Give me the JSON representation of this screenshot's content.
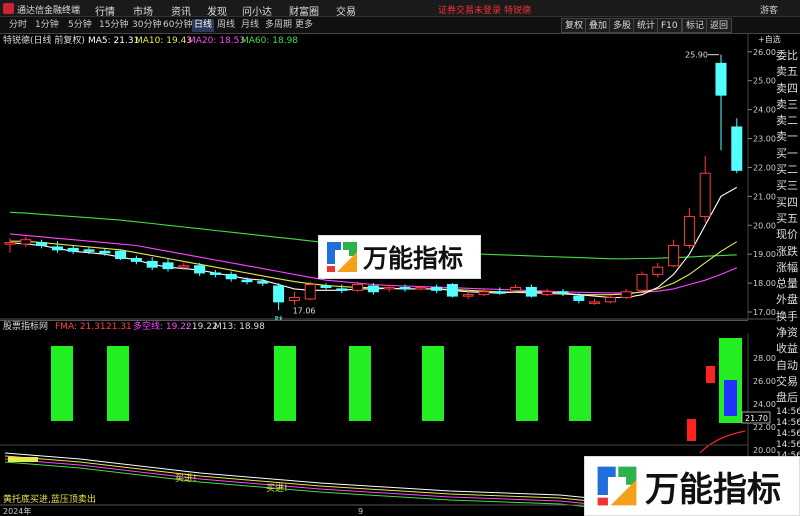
{
  "app": {
    "title": "通达信金融终端",
    "menu": [
      "行情",
      "市场",
      "资讯",
      "发现",
      "问小达",
      "财富圈",
      "交易"
    ],
    "status": "证券交易未登录",
    "stock_tag": "特锐德",
    "user": "游客"
  },
  "toolbar": {
    "timeframes": [
      "分时",
      "1分钟",
      "5分钟",
      "15分钟",
      "30分钟",
      "60分钟",
      "日线",
      "周线",
      "月线",
      "多周期",
      "更多"
    ],
    "active_timeframe": "日线",
    "tools": [
      "复权",
      "叠加",
      "多股",
      "统计",
      "F10",
      "标记",
      "返回"
    ]
  },
  "info": {
    "stock": "特锐德(日线 前复权)",
    "ma5": "MA5: 21.31",
    "ma10": "MA10: 19.43",
    "ma20": "MA20: 18.53",
    "ma60": "MA60: 18.98",
    "self_select": "+自选",
    "colors": {
      "ma5": "#ffffff",
      "ma10": "#e8e84a",
      "ma20": "#ff44ff",
      "ma60": "#44dd44"
    }
  },
  "right_panel": [
    "委比",
    "卖五",
    "卖四",
    "卖三",
    "卖二",
    "卖一",
    "买一",
    "买二",
    "买三",
    "买四",
    "买五",
    "现价",
    "涨跌",
    "涨幅",
    "总量",
    "外盘",
    "换手",
    "净资",
    "收益",
    "自动",
    "交易",
    "盘后",
    "14:56",
    "14:56",
    "14:56",
    "14:56",
    "14:56"
  ],
  "price_axis": [
    "26.00",
    "25.00",
    "24.00",
    "23.00",
    "22.00",
    "21.00",
    "20.00",
    "19.00",
    "18.00",
    "17.00"
  ],
  "price_labels": {
    "high": "25.90",
    "low": "17.06",
    "fin": "财"
  },
  "sub": {
    "title": "股票指标网",
    "fma": "FMA: 21.31",
    "fma2": "21.31",
    "duokong": "多空线: 19.22",
    "v2": ": 19.22",
    "m13": "M13: 18.98",
    "colors": {
      "fma": "#ff4444",
      "duokong": "#ff44ff",
      "m13": "#dddddd"
    },
    "axis": [
      "28.00",
      "26.00",
      "24.00",
      "22.00",
      "20.00"
    ],
    "value_label": "21.70"
  },
  "lower": {
    "signal1": "买进!",
    "signal2": "买进!",
    "legend": "黄托底买进,蓝压顶卖出",
    "year": "2024年",
    "month": "9"
  },
  "watermark": "万能指标",
  "chart_data": {
    "type": "candlestick",
    "ylim": [
      17.0,
      26.2
    ],
    "candles": [
      {
        "o": 19.35,
        "c": 19.4,
        "h": 19.55,
        "l": 19.05
      },
      {
        "o": 19.35,
        "c": 19.5,
        "h": 19.6,
        "l": 19.25
      },
      {
        "o": 19.4,
        "c": 19.3,
        "h": 19.5,
        "l": 19.2
      },
      {
        "o": 19.25,
        "c": 19.15,
        "h": 19.45,
        "l": 19.05
      },
      {
        "o": 19.2,
        "c": 19.1,
        "h": 19.3,
        "l": 19.0
      },
      {
        "o": 19.15,
        "c": 19.1,
        "h": 19.25,
        "l": 19.0
      },
      {
        "o": 19.1,
        "c": 19.05,
        "h": 19.2,
        "l": 18.95
      },
      {
        "o": 19.1,
        "c": 18.85,
        "h": 19.15,
        "l": 18.8
      },
      {
        "o": 18.85,
        "c": 18.75,
        "h": 18.95,
        "l": 18.65
      },
      {
        "o": 18.75,
        "c": 18.55,
        "h": 18.9,
        "l": 18.45
      },
      {
        "o": 18.7,
        "c": 18.5,
        "h": 18.85,
        "l": 18.4
      },
      {
        "o": 18.55,
        "c": 18.6,
        "h": 18.7,
        "l": 18.45
      },
      {
        "o": 18.6,
        "c": 18.35,
        "h": 18.7,
        "l": 18.25
      },
      {
        "o": 18.35,
        "c": 18.3,
        "h": 18.45,
        "l": 18.2
      },
      {
        "o": 18.3,
        "c": 18.15,
        "h": 18.4,
        "l": 18.05
      },
      {
        "o": 18.1,
        "c": 18.05,
        "h": 18.2,
        "l": 17.95
      },
      {
        "o": 18.05,
        "c": 18.0,
        "h": 18.15,
        "l": 17.9
      },
      {
        "o": 17.9,
        "c": 17.35,
        "h": 18.0,
        "l": 17.06
      },
      {
        "o": 17.4,
        "c": 17.5,
        "h": 17.7,
        "l": 17.25
      },
      {
        "o": 17.45,
        "c": 17.95,
        "h": 18.05,
        "l": 17.4
      },
      {
        "o": 17.9,
        "c": 17.85,
        "h": 18.0,
        "l": 17.75
      },
      {
        "o": 17.8,
        "c": 17.75,
        "h": 17.95,
        "l": 17.65
      },
      {
        "o": 17.75,
        "c": 17.95,
        "h": 18.05,
        "l": 17.7
      },
      {
        "o": 17.9,
        "c": 17.7,
        "h": 18.0,
        "l": 17.6
      },
      {
        "o": 17.8,
        "c": 17.85,
        "h": 17.95,
        "l": 17.7
      },
      {
        "o": 17.85,
        "c": 17.8,
        "h": 17.95,
        "l": 17.7
      },
      {
        "o": 17.8,
        "c": 17.85,
        "h": 17.9,
        "l": 17.75
      },
      {
        "o": 17.85,
        "c": 17.75,
        "h": 17.95,
        "l": 17.65
      },
      {
        "o": 17.95,
        "c": 17.55,
        "h": 18.0,
        "l": 17.5
      },
      {
        "o": 17.55,
        "c": 17.6,
        "h": 17.7,
        "l": 17.45
      },
      {
        "o": 17.6,
        "c": 17.7,
        "h": 17.8,
        "l": 17.55
      },
      {
        "o": 17.7,
        "c": 17.65,
        "h": 17.85,
        "l": 17.6
      },
      {
        "o": 17.75,
        "c": 17.85,
        "h": 17.95,
        "l": 17.7
      },
      {
        "o": 17.85,
        "c": 17.55,
        "h": 17.95,
        "l": 17.5
      },
      {
        "o": 17.6,
        "c": 17.7,
        "h": 17.8,
        "l": 17.55
      },
      {
        "o": 17.7,
        "c": 17.65,
        "h": 17.8,
        "l": 17.55
      },
      {
        "o": 17.55,
        "c": 17.4,
        "h": 17.65,
        "l": 17.3
      },
      {
        "o": 17.3,
        "c": 17.35,
        "h": 17.45,
        "l": 17.25
      },
      {
        "o": 17.35,
        "c": 17.5,
        "h": 17.6,
        "l": 17.3
      },
      {
        "o": 17.5,
        "c": 17.7,
        "h": 17.8,
        "l": 17.45
      },
      {
        "o": 17.75,
        "c": 18.3,
        "h": 18.4,
        "l": 17.7
      },
      {
        "o": 18.3,
        "c": 18.55,
        "h": 18.7,
        "l": 18.2
      },
      {
        "o": 18.6,
        "c": 19.3,
        "h": 19.5,
        "l": 18.55
      },
      {
        "o": 19.3,
        "c": 20.3,
        "h": 20.6,
        "l": 19.2
      },
      {
        "o": 20.3,
        "c": 21.8,
        "h": 22.4,
        "l": 20.1
      },
      {
        "o": 25.6,
        "c": 24.5,
        "h": 25.9,
        "l": 22.6
      },
      {
        "o": 23.4,
        "c": 21.9,
        "h": 23.7,
        "l": 21.8
      }
    ],
    "ma5": [
      19.4,
      19.35,
      19.3,
      19.2,
      19.1,
      19.05,
      19.0,
      18.9,
      18.8,
      18.65,
      18.55,
      18.5,
      18.45,
      18.35,
      18.25,
      18.15,
      18.1,
      17.95,
      17.8,
      17.75,
      17.75,
      17.75,
      17.8,
      17.8,
      17.82,
      17.8,
      17.8,
      17.8,
      17.75,
      17.7,
      17.68,
      17.65,
      17.7,
      17.7,
      17.68,
      17.65,
      17.6,
      17.55,
      17.5,
      17.5,
      17.6,
      17.85,
      18.3,
      19.0,
      20.0,
      21.0,
      21.31
    ],
    "ma10": [
      19.45,
      19.45,
      19.4,
      19.35,
      19.3,
      19.25,
      19.2,
      19.15,
      19.05,
      18.95,
      18.85,
      18.75,
      18.65,
      18.55,
      18.45,
      18.35,
      18.25,
      18.15,
      18.05,
      17.98,
      17.92,
      17.88,
      17.85,
      17.84,
      17.82,
      17.8,
      17.8,
      17.8,
      17.78,
      17.75,
      17.72,
      17.7,
      17.68,
      17.66,
      17.64,
      17.62,
      17.6,
      17.6,
      17.6,
      17.62,
      17.7,
      17.8,
      18.0,
      18.3,
      18.7,
      19.1,
      19.43
    ],
    "ma20": [
      19.7,
      19.65,
      19.6,
      19.55,
      19.5,
      19.45,
      19.4,
      19.35,
      19.3,
      19.2,
      19.1,
      19.0,
      18.9,
      18.8,
      18.7,
      18.6,
      18.5,
      18.4,
      18.3,
      18.2,
      18.1,
      18.05,
      18.0,
      17.95,
      17.92,
      17.9,
      17.88,
      17.86,
      17.84,
      17.82,
      17.8,
      17.78,
      17.76,
      17.74,
      17.72,
      17.7,
      17.68,
      17.67,
      17.66,
      17.66,
      17.68,
      17.72,
      17.8,
      17.95,
      18.1,
      18.3,
      18.53
    ],
    "ma60": [
      20.45,
      20.42,
      20.38,
      20.34,
      20.3,
      20.26,
      20.22,
      20.18,
      20.12,
      20.06,
      20.0,
      19.94,
      19.88,
      19.82,
      19.76,
      19.7,
      19.64,
      19.58,
      19.52,
      19.46,
      19.4,
      19.35,
      19.3,
      19.25,
      19.2,
      19.16,
      19.12,
      19.08,
      19.05,
      19.02,
      19.0,
      18.98,
      18.96,
      18.94,
      18.92,
      18.9,
      18.88,
      18.86,
      18.84,
      18.84,
      18.85,
      18.86,
      18.88,
      18.9,
      18.93,
      18.95,
      18.98
    ],
    "sub_bars_green_index": [
      2,
      4,
      11,
      14,
      17,
      20,
      22,
      37
    ],
    "sub_bars_red_index": [
      36,
      35
    ],
    "sub_bar_blue_index": 38
  }
}
